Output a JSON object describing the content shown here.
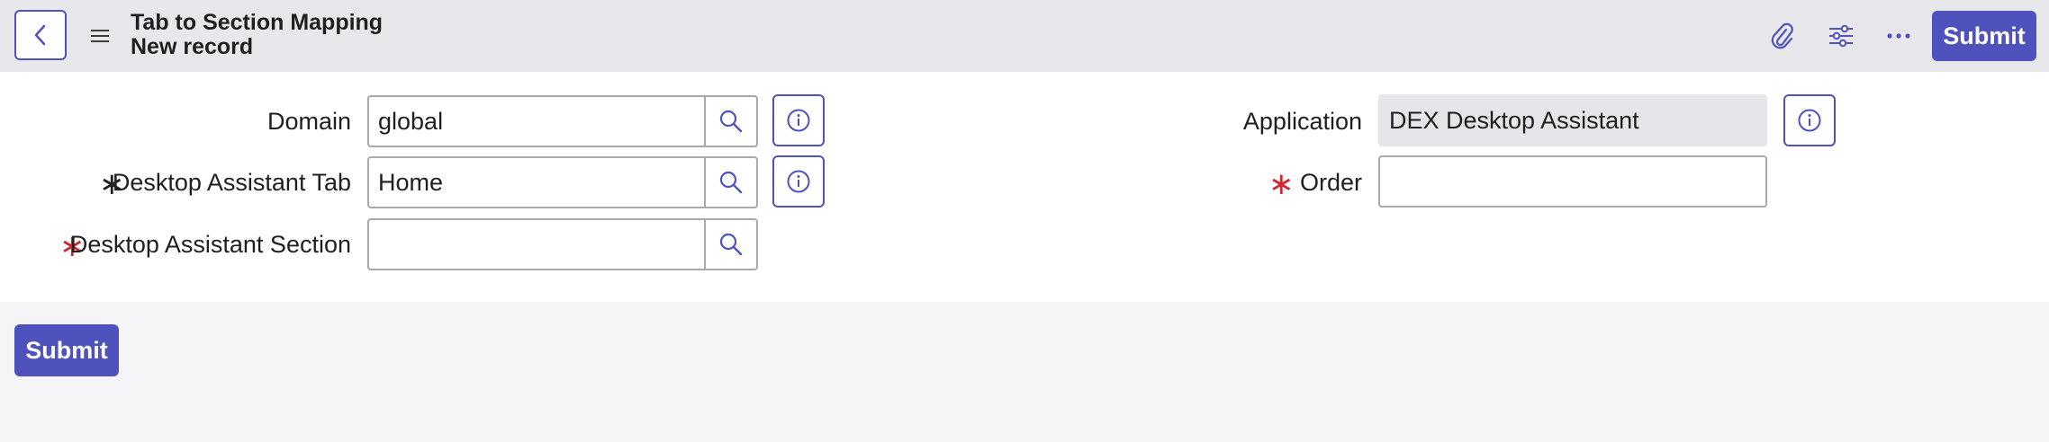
{
  "header": {
    "title_line1": "Tab to Section Mapping",
    "title_line2": "New record",
    "icons": [
      "back-icon",
      "hamburger-menu-icon",
      "paperclip-icon",
      "sliders-icon",
      "more-ellipsis-icon"
    ],
    "submit_label": "Submit"
  },
  "form": {
    "domain": {
      "label": "Domain",
      "value": "global"
    },
    "tab": {
      "label": "Desktop Assistant Tab",
      "value": "Home",
      "required_marker": "∗"
    },
    "section": {
      "label": "Desktop Assistant Section",
      "value": "",
      "required_marker": "∗"
    },
    "application": {
      "label": "Application",
      "value": "DEX Desktop Assistant"
    },
    "order": {
      "label": "Order",
      "value": "",
      "required_marker": "∗"
    }
  },
  "footer": {
    "submit_label": "Submit"
  },
  "colors": {
    "accent": "#4f52bd",
    "required": "#d0262f",
    "header_bg": "#e8e8ec",
    "page_bg": "#f5f5f7"
  }
}
